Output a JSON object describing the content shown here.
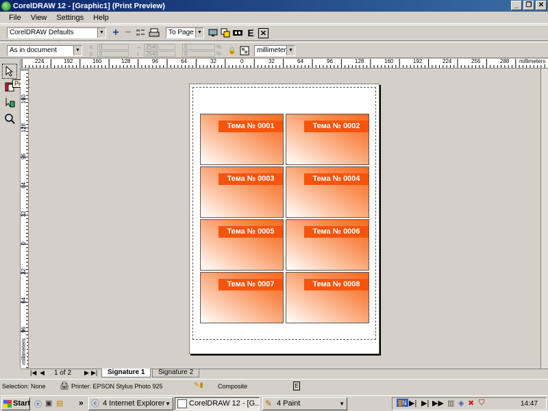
{
  "window": {
    "title": "CorelDRAW 12 - [Graphic1] (Print Preview)"
  },
  "menu": [
    "File",
    "View",
    "Settings",
    "Help"
  ],
  "toolbar1": {
    "preset": "CorelDRAW Defaults",
    "fit": "To Page"
  },
  "toolbar2": {
    "position": "As in document",
    "x": "0",
    "y": "0",
    "w": "2540",
    "h": "2540",
    "sx": "0",
    "sy": "0",
    "units": "millimeters"
  },
  "tooltip": "Pick Tool",
  "ruler_h": {
    "ticks": [
      "224",
      "192",
      "160",
      "128",
      "96",
      "64",
      "32",
      "0",
      "32",
      "64",
      "96",
      "128",
      "160",
      "192",
      "224",
      "256",
      "288"
    ],
    "units": "millimeters"
  },
  "ruler_v": {
    "ticks": [
      "160",
      "128",
      "96",
      "64",
      "32",
      "0",
      "32",
      "64",
      "96"
    ],
    "units": "millimeters"
  },
  "cards": [
    "Тема № 0001",
    "Тема № 0002",
    "Тема № 0003",
    "Тема № 0004",
    "Тема № 0005",
    "Тема № 0006",
    "Тема № 0007",
    "Тема № 0008"
  ],
  "pages": {
    "counter": "1 of 2",
    "tabs": [
      "Signature 1",
      "Signature 2"
    ]
  },
  "status": {
    "selection": "Selection: None",
    "printer": "Printer: EPSON Stylus Photo 925",
    "mode": "Composite"
  },
  "taskbar": {
    "start": "Start",
    "buttons": [
      "4 Internet Explorer",
      "CorelDRAW 12 - [G...",
      "4 Paint"
    ],
    "lang": "EN",
    "clock": "14:47"
  },
  "colors": {
    "card_top": "#f96a22",
    "card_label": "#f6540c",
    "title_bar": "#0a246a"
  }
}
